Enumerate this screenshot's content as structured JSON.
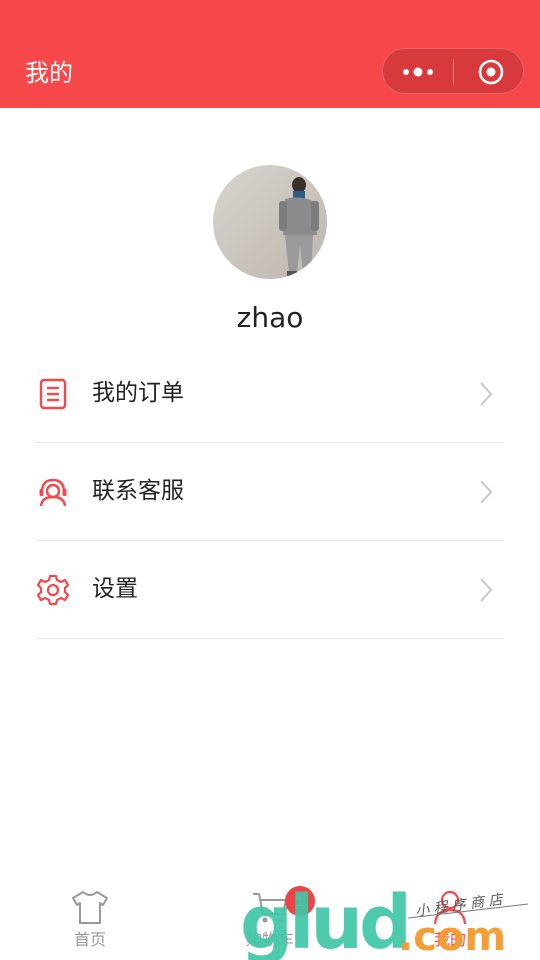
{
  "header": {
    "title": "我的"
  },
  "capsule": {
    "more_icon": "more-dots-icon",
    "close_icon": "target-close-icon"
  },
  "profile": {
    "username": "zhao"
  },
  "menu": [
    {
      "label": "我的订单",
      "icon": "order-list-icon"
    },
    {
      "label": "联系客服",
      "icon": "customer-service-icon"
    },
    {
      "label": "设置",
      "icon": "gear-icon"
    }
  ],
  "tabbar": {
    "tabs": [
      {
        "label": "首页",
        "icon": "tshirt-icon",
        "active": false
      },
      {
        "label": "购物车",
        "icon": "cart-icon",
        "active": false,
        "badge": "1"
      },
      {
        "label": "我的",
        "icon": "user-icon",
        "active": true
      }
    ]
  },
  "watermark": {
    "brand": "glud",
    "suffix": ".com",
    "tagline": "小程序商店"
  },
  "colors": {
    "brand_red": "#f6474b",
    "separator": "#e5e5e5",
    "inactive_tab": "#999999"
  }
}
